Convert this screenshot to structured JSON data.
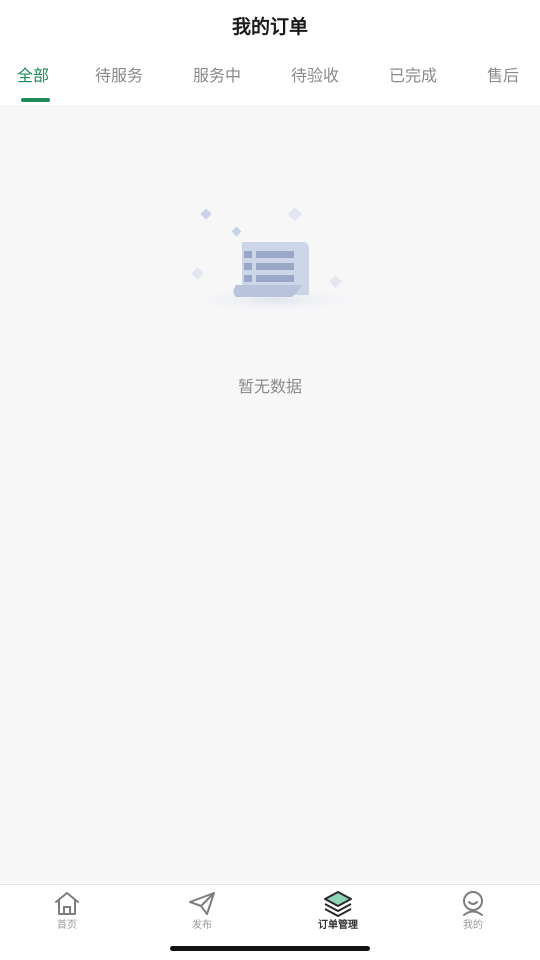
{
  "header": {
    "title": "我的订单"
  },
  "tabs": [
    {
      "label": "全部",
      "active": true
    },
    {
      "label": "待服务",
      "active": false
    },
    {
      "label": "服务中",
      "active": false
    },
    {
      "label": "待验收",
      "active": false
    },
    {
      "label": "已完成",
      "active": false
    },
    {
      "label": "售后",
      "active": false
    }
  ],
  "empty_state": {
    "icon": "document-scroll-icon",
    "text": "暂无数据"
  },
  "tabbar": {
    "items": [
      {
        "label": "首页",
        "icon": "home-icon",
        "active": false
      },
      {
        "label": "发布",
        "icon": "send-icon",
        "active": false
      },
      {
        "label": "订单管理",
        "icon": "layers-icon",
        "active": true
      },
      {
        "label": "我的",
        "icon": "user-icon",
        "active": false
      }
    ]
  },
  "colors": {
    "accent": "#1f8a5a",
    "background": "#f7f7f8",
    "tab_inactive": "#8a8a8a"
  }
}
